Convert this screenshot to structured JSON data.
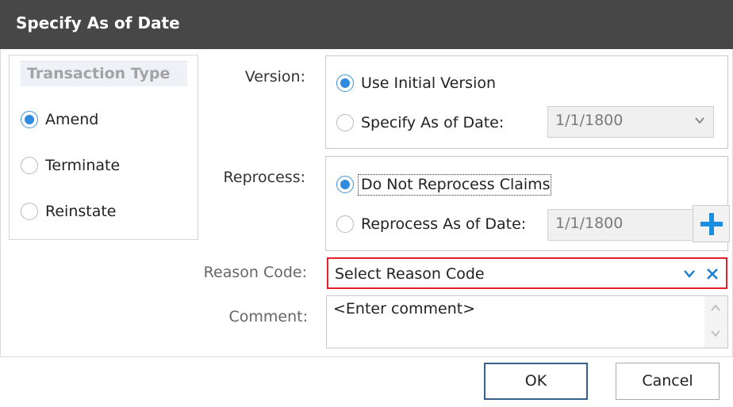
{
  "dialog": {
    "title": "Specify As of Date"
  },
  "transaction_type": {
    "header": "Transaction Type",
    "options": [
      {
        "label": "Amend",
        "selected": true
      },
      {
        "label": "Terminate",
        "selected": false
      },
      {
        "label": "Reinstate",
        "selected": false
      }
    ]
  },
  "version": {
    "label": "Version:",
    "options": [
      {
        "label": "Use Initial Version",
        "selected": true
      },
      {
        "label": "Specify As of Date:",
        "selected": false
      }
    ],
    "date_value": "1/1/1800"
  },
  "reprocess": {
    "label": "Reprocess:",
    "options": [
      {
        "label": "Do Not Reprocess Claims",
        "selected": true
      },
      {
        "label": "Reprocess As of Date:",
        "selected": false
      }
    ],
    "date_value": "1/1/1800"
  },
  "reason_code": {
    "label": "Reason Code:",
    "value": "Select Reason Code"
  },
  "comment": {
    "label": "Comment:",
    "placeholder": "<Enter comment>"
  },
  "buttons": {
    "ok": "OK",
    "cancel": "Cancel"
  },
  "colors": {
    "titlebar": "#474747",
    "radio_accent": "#2f8ae0",
    "reason_border": "#e0212b",
    "plus_icon": "#1a8ee0",
    "primary_border": "#3a5f88"
  }
}
